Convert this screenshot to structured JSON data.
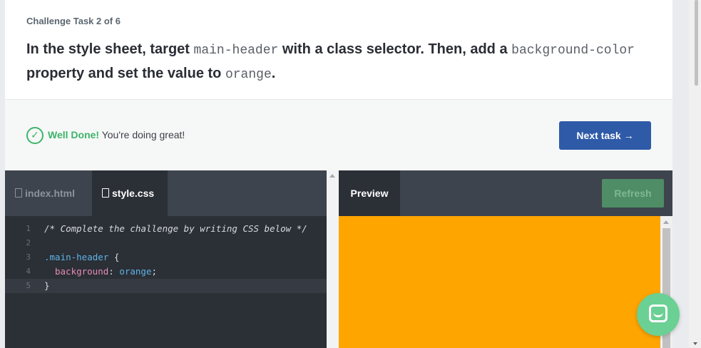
{
  "task": {
    "counter": "Challenge Task 2 of 6",
    "text_1": "In the style sheet, target ",
    "code_1": "main-header",
    "text_2": " with a class selector. Then, add a ",
    "code_2": "background-color",
    "text_3": " property and set the value to ",
    "code_3": "orange",
    "text_4": "."
  },
  "feedback": {
    "icon": "check-circle-icon",
    "strong": "Well Done!",
    "message": " You're doing great!",
    "next_label": "Next task →"
  },
  "editor": {
    "tabs": [
      {
        "label": "index.html",
        "active": false
      },
      {
        "label": "style.css",
        "active": true
      }
    ],
    "lines": [
      {
        "num": "1",
        "comment": "/* Complete the challenge by writing CSS below */"
      },
      {
        "num": "2"
      },
      {
        "num": "3",
        "selector": ".main-header",
        "punc": " {"
      },
      {
        "num": "4",
        "property": "background",
        "colon": ": ",
        "value": "orange",
        "end": ";"
      },
      {
        "num": "5",
        "punc": "}"
      }
    ]
  },
  "preview": {
    "tab_label": "Preview",
    "refresh_label": "Refresh",
    "background_color": "#ffa500"
  },
  "colors": {
    "accent_blue": "#2e5aa8",
    "success_green": "#3eb36b",
    "editor_bg": "#2b2f36"
  }
}
